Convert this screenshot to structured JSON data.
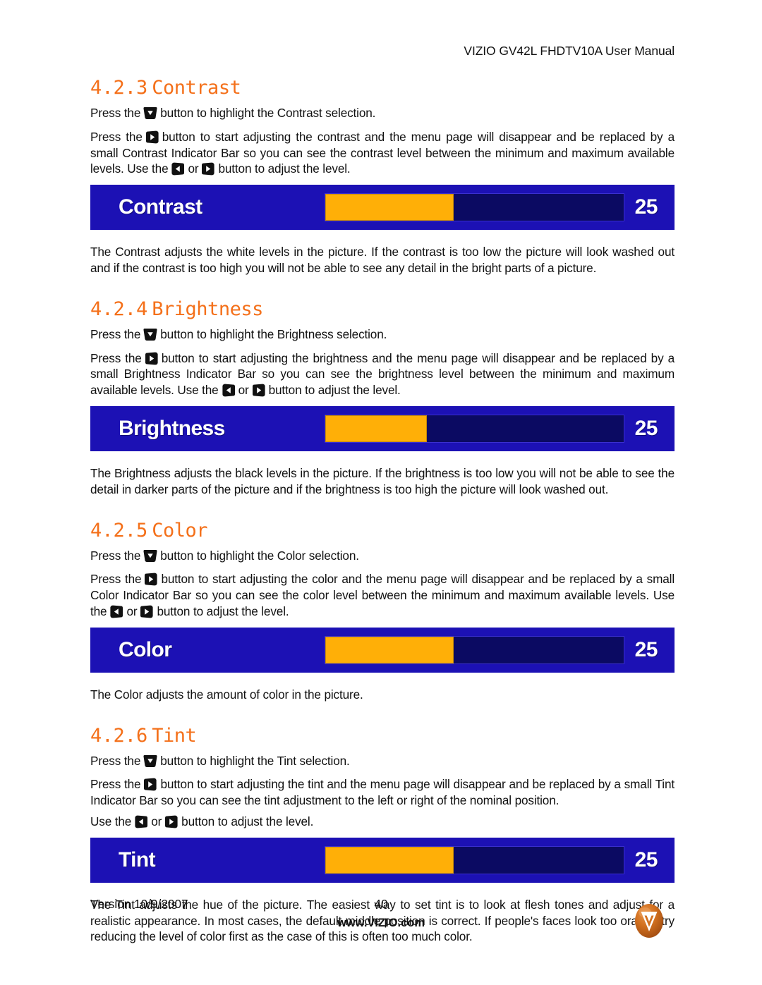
{
  "header": {
    "title": "VIZIO GV42L FHDTV10A User Manual"
  },
  "sections": [
    {
      "number": "4.2.3",
      "title": "Contrast",
      "para1_a": "Press the",
      "para1_b": "button to highlight the Contrast selection.",
      "para2_a": "Press the",
      "para2_b": "button to start adjusting the contrast and the menu page will disappear and be replaced by a small Contrast Indicator Bar so you can see the contrast level between the minimum and maximum available levels.  Use the",
      "para2_c": "or",
      "para2_d": "button to adjust the level.",
      "bar": {
        "label": "Contrast",
        "value": "25",
        "fill_percent": 43
      },
      "para3": "The Contrast adjusts the white levels in the picture.  If the contrast is too low the picture will look washed out and if the contrast is too high you will not be able to see any detail in the bright parts of a picture."
    },
    {
      "number": "4.2.4",
      "title": "Brightness",
      "para1_a": "Press the",
      "para1_b": "button to highlight the Brightness selection.",
      "para2_a": "Press the",
      "para2_b": "button to start adjusting the brightness and the menu page will disappear and be replaced by a small Brightness Indicator Bar so you can see the brightness level between the minimum and maximum available levels.  Use the",
      "para2_c": "or",
      "para2_d": "button to adjust the level.",
      "bar": {
        "label": "Brightness",
        "value": "25",
        "fill_percent": 34
      },
      "para3": "The Brightness adjusts the black levels in the picture.  If the brightness is too low you will not be able to see the detail in darker parts of the picture and if the brightness is too high the picture will look washed out."
    },
    {
      "number": "4.2.5",
      "title": "Color",
      "para1_a": "Press the",
      "para1_b": "button to highlight the Color selection.",
      "para2_a": "Press the",
      "para2_b": "button to start adjusting the color and the menu page will disappear and be replaced by a small Color Indicator Bar so you can see the color level between the minimum and maximum available levels.  Use the",
      "para2_c": "or",
      "para2_d": "button to adjust the level.",
      "bar": {
        "label": "Color",
        "value": "25",
        "fill_percent": 43
      },
      "para3": "The Color adjusts the amount of color in the picture."
    },
    {
      "number": "4.2.6",
      "title": "Tint",
      "para1_a": "Press the",
      "para1_b": "button to highlight the Tint selection.",
      "para2_a": "Press the",
      "para2_b": "button to start adjusting the tint and the menu page will disappear and be replaced by a small Tint Indicator Bar so you can see the tint adjustment to the left or right of the nominal position.",
      "para2_c": "Use the",
      "para2_d": "or",
      "para2_e": "button to adjust the level.",
      "bar": {
        "label": "Tint",
        "value": "25",
        "fill_percent": 43
      },
      "para3": "The Tint adjusts the hue of the picture.  The easiest way to set tint is to look at flesh tones and adjust for a realistic appearance.  In most cases, the default middle position is correct.  If people's faces look too orange try reducing the level of color first as the case of this is often too much color."
    }
  ],
  "icons": {
    "down": "arrow-down-button-icon",
    "right": "arrow-right-button-icon",
    "left": "arrow-left-button-icon",
    "logo": "vizio-logo-icon"
  },
  "footer": {
    "version": "Version 10/9/2007",
    "page_number": "40",
    "website": "www.VIZIO.com"
  },
  "colors": {
    "heading_orange": "#F4701A",
    "osd_background": "#1C11B4",
    "osd_track": "#0B0A62",
    "osd_fill": "#FFAF07",
    "logo_orange": "#D4701E"
  }
}
